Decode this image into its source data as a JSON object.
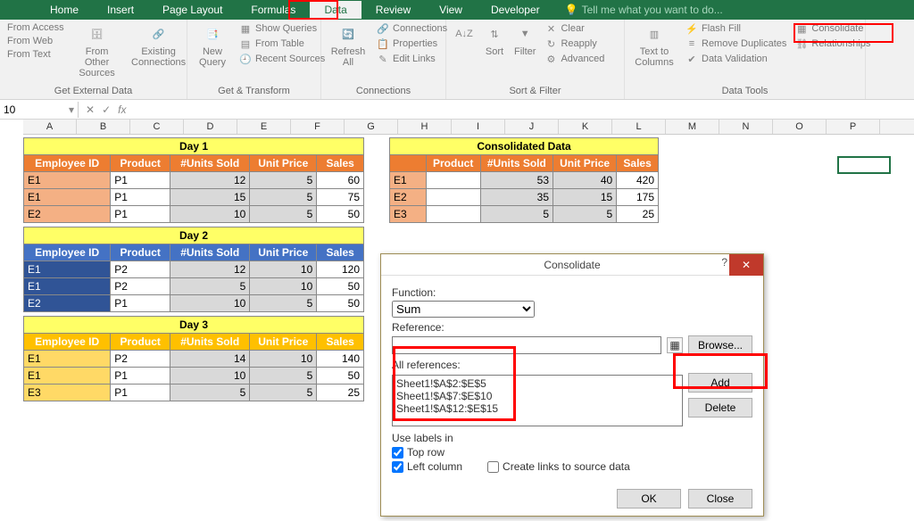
{
  "tabs": [
    "Home",
    "Insert",
    "Page Layout",
    "Formulas",
    "Data",
    "Review",
    "View",
    "Developer"
  ],
  "active_tab_index": 4,
  "tell_me": "Tell me what you want to do...",
  "ribbon": {
    "get_external": {
      "label": "Get External Data",
      "access": "From Access",
      "web": "From Web",
      "text": "From Text",
      "other": "From Other Sources",
      "existing": "Existing Connections"
    },
    "get_transform": {
      "label": "Get & Transform",
      "newq": "New Query",
      "show": "Show Queries",
      "table": "From Table",
      "recent": "Recent Sources"
    },
    "connections": {
      "label": "Connections",
      "refresh": "Refresh All",
      "conn": "Connections",
      "prop": "Properties",
      "edit": "Edit Links"
    },
    "sortfilter": {
      "label": "Sort & Filter",
      "sort": "Sort",
      "filter": "Filter",
      "clear": "Clear",
      "reapply": "Reapply",
      "adv": "Advanced"
    },
    "datatools": {
      "label": "Data Tools",
      "t2c": "Text to Columns",
      "flash": "Flash Fill",
      "dup": "Remove Duplicates",
      "valid": "Data Validation",
      "consol": "Consolidate",
      "rel": "Relationships"
    }
  },
  "name_box": "10",
  "columns": [
    "A",
    "B",
    "C",
    "D",
    "E",
    "F",
    "G",
    "H",
    "I",
    "J",
    "K",
    "L",
    "M",
    "N",
    "O",
    "P"
  ],
  "chart_data": {
    "type": "table",
    "tables": [
      {
        "title": "Day 1",
        "headers": [
          "Employee ID",
          "Product",
          "#Units Sold",
          "Unit Price",
          "Sales"
        ],
        "header_style": "orange",
        "rows": [
          [
            "E1",
            "P1",
            12,
            5,
            60
          ],
          [
            "E1",
            "P1",
            15,
            5,
            75
          ],
          [
            "E2",
            "P1",
            10,
            5,
            50
          ]
        ]
      },
      {
        "title": "Day 2",
        "headers": [
          "Employee ID",
          "Product",
          "#Units Sold",
          "Unit Price",
          "Sales"
        ],
        "header_style": "blue",
        "rows": [
          [
            "E1",
            "P2",
            12,
            10,
            120
          ],
          [
            "E1",
            "P2",
            5,
            10,
            50
          ],
          [
            "E2",
            "P1",
            10,
            5,
            50
          ]
        ]
      },
      {
        "title": "Day 3",
        "headers": [
          "Employee ID",
          "Product",
          "#Units Sold",
          "Unit Price",
          "Sales"
        ],
        "header_style": "gold",
        "rows": [
          [
            "E1",
            "P2",
            14,
            10,
            140
          ],
          [
            "E1",
            "P1",
            10,
            5,
            50
          ],
          [
            "E3",
            "P1",
            5,
            5,
            25
          ]
        ]
      },
      {
        "title": "Consolidated Data",
        "headers": [
          "",
          "Product",
          "#Units Sold",
          "Unit Price",
          "Sales"
        ],
        "header_style": "orange",
        "rows": [
          [
            "E1",
            "",
            53,
            40,
            420
          ],
          [
            "E2",
            "",
            35,
            15,
            175
          ],
          [
            "E3",
            "",
            5,
            5,
            25
          ]
        ]
      }
    ]
  },
  "dialog": {
    "title": "Consolidate",
    "function_label": "Function:",
    "function_value": "Sum",
    "reference_label": "Reference:",
    "reference_value": "",
    "browse": "Browse...",
    "allrefs_label": "All references:",
    "refs": [
      "Sheet1!$A$2:$E$5",
      "Sheet1!$A$7:$E$10",
      "Sheet1!$A$12:$E$15"
    ],
    "add": "Add",
    "delete": "Delete",
    "use_labels": "Use labels in",
    "top_row": "Top row",
    "left_col": "Left column",
    "create_links": "Create links to source data",
    "ok": "OK",
    "close": "Close"
  }
}
